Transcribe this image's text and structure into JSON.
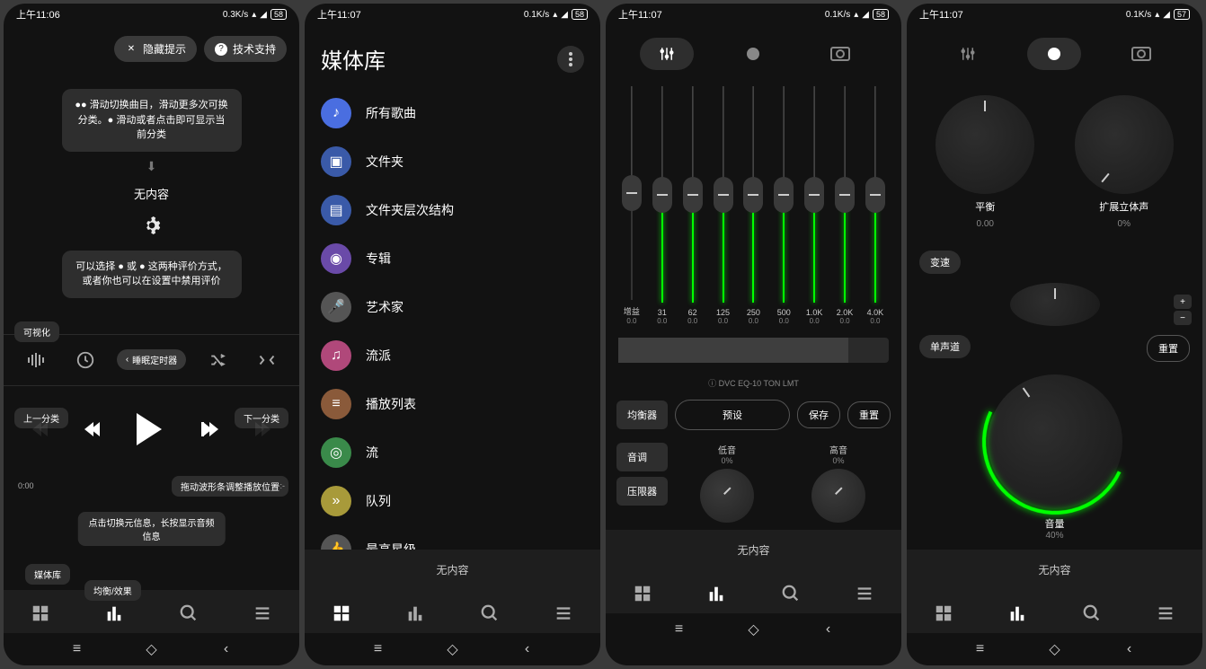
{
  "status": {
    "time1": "上午11:06",
    "time2": "上午11:07",
    "speed1": "0.3K/s",
    "speed2": "0.1K/s",
    "batt1": "58",
    "batt2": "57"
  },
  "p1": {
    "hide_hint": "隐藏提示",
    "support": "技术支持",
    "tip1": "●● 滑动切换曲目，滑动更多次可换分类。● 滑动或者点击即可显示当前分类",
    "no_content": "无内容",
    "tip2": "可以选择 ● 或 ● 这两种评价方式，或者你也可以在设置中禁用评价",
    "visualize": "可视化",
    "sleep_timer": "睡眠定时器",
    "prev_cat": "上一分类",
    "next_cat": "下一分类",
    "drag_wave": "拖动波形条调整播放位置",
    "time_start": "0:00",
    "time_end": "-:-",
    "tap_meta": "点击切换元信息，长按显示音频信息",
    "library": "媒体库",
    "eq_fx": "均衡/效果"
  },
  "p2": {
    "title": "媒体库",
    "items": [
      {
        "label": "所有歌曲",
        "color": "#4a6ee0"
      },
      {
        "label": "文件夹",
        "color": "#3a5aa8"
      },
      {
        "label": "文件夹层次结构",
        "color": "#3a5aa8"
      },
      {
        "label": "专辑",
        "color": "#6a4aa8"
      },
      {
        "label": "艺术家",
        "color": "#555"
      },
      {
        "label": "流派",
        "color": "#b0487a"
      },
      {
        "label": "播放列表",
        "color": "#8a5a3a"
      },
      {
        "label": "流",
        "color": "#3a8a4a"
      },
      {
        "label": "队列",
        "color": "#a89a3a"
      },
      {
        "label": "最高星级",
        "color": "#555"
      }
    ],
    "no_content": "无内容"
  },
  "p3": {
    "bands": [
      {
        "f": "增益",
        "v": "0.0",
        "glow": false
      },
      {
        "f": "31",
        "v": "0.0",
        "glow": true
      },
      {
        "f": "62",
        "v": "0.0",
        "glow": true
      },
      {
        "f": "125",
        "v": "0.0",
        "glow": true
      },
      {
        "f": "250",
        "v": "0.0",
        "glow": true
      },
      {
        "f": "500",
        "v": "0.0",
        "glow": true
      },
      {
        "f": "1.0K",
        "v": "0.0",
        "glow": true
      },
      {
        "f": "2.0K",
        "v": "0.0",
        "glow": true
      },
      {
        "f": "4.0K",
        "v": "0.0",
        "glow": true
      }
    ],
    "dsp": "ⓘ DVC EQ-10 TON LMT",
    "eq": "均衡器",
    "preset": "预设",
    "save": "保存",
    "reset": "重置",
    "tone": "音调",
    "bass": "低音",
    "bass_v": "0%",
    "treble": "高音",
    "treble_v": "0%",
    "limiter": "压限器",
    "no_content": "无内容"
  },
  "p4": {
    "balance": "平衡",
    "balance_v": "0.00",
    "stereo": "扩展立体声",
    "stereo_v": "0%",
    "speed": "变速",
    "mono": "单声道",
    "reset": "重置",
    "volume": "音量",
    "volume_v": "40%",
    "no_content": "无内容"
  }
}
